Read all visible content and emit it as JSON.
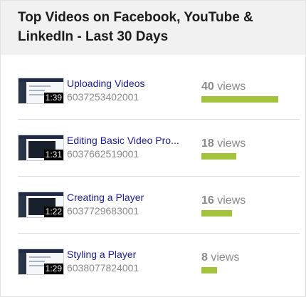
{
  "title": "Top Videos on Facebook, YouTube & LinkedIn - Last 30 Days",
  "views_label": "views",
  "colors": {
    "bar": "#a3c33b",
    "link": "#1a1a99",
    "header_bg": "#f1f1f1"
  },
  "videos": [
    {
      "name": "Uploading Videos",
      "id": "6037253402001",
      "duration": "1:39",
      "views": "40",
      "views_fraction": 1.0,
      "thumb": "light"
    },
    {
      "name": "Editing Basic Video Pro...",
      "id": "6037662519001",
      "duration": "1:31",
      "views": "18",
      "views_fraction": 0.45,
      "thumb": "dark"
    },
    {
      "name": "Creating a Player",
      "id": "6037729683001",
      "duration": "1:22",
      "views": "16",
      "views_fraction": 0.4,
      "thumb": "dark"
    },
    {
      "name": "Styling a Player",
      "id": "6038077824001",
      "duration": "1:29",
      "views": "8",
      "views_fraction": 0.2,
      "thumb": "light"
    }
  ]
}
